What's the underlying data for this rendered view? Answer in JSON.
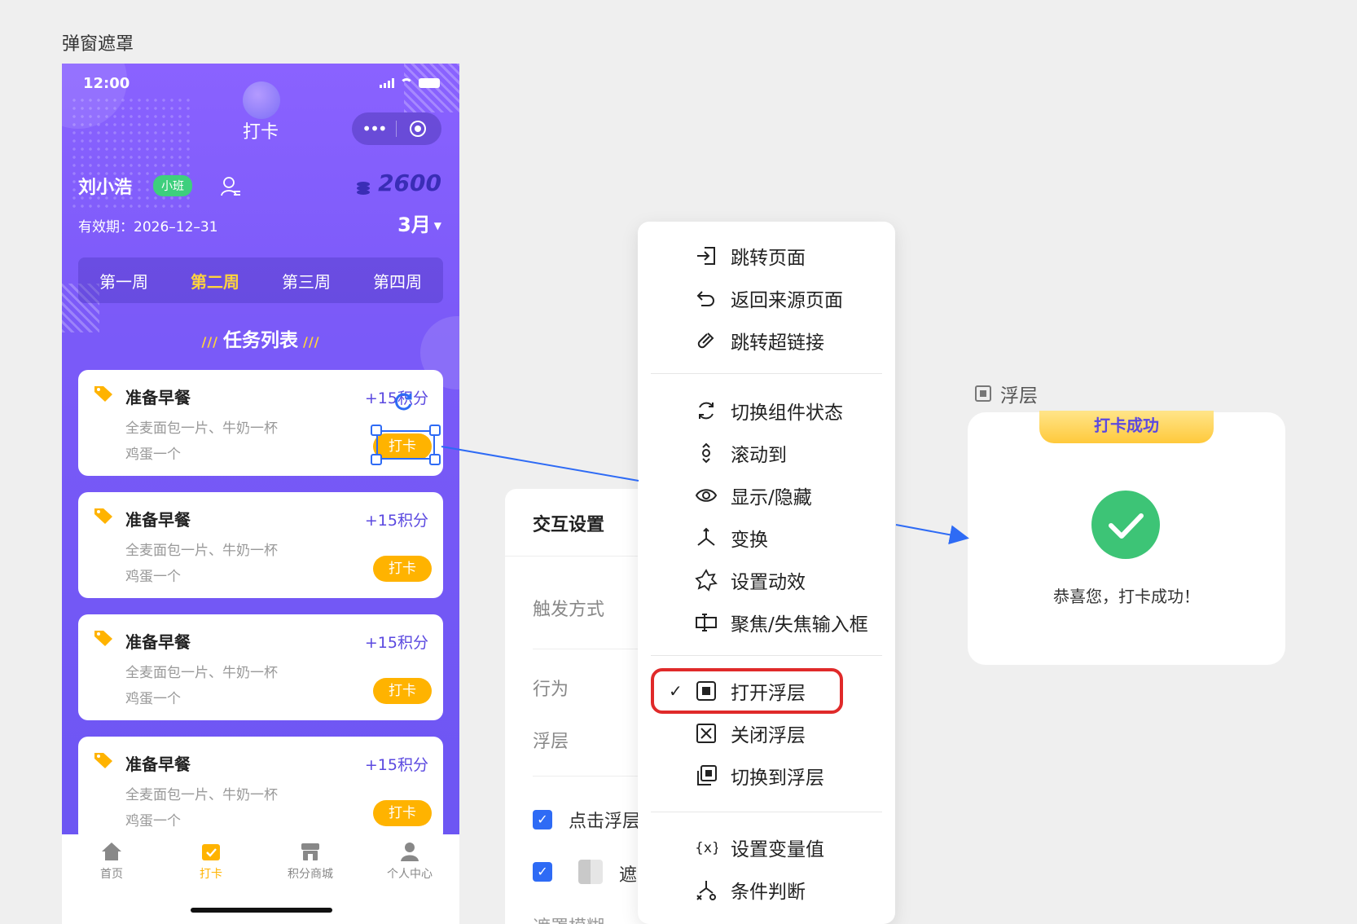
{
  "canvas_title": "弹窗遮罩",
  "phone": {
    "status_time": "12:00",
    "nav_title": "打卡",
    "capsule_more": "•••",
    "user_name": "刘小浩",
    "class_badge": "小班",
    "points": "2600",
    "validity": "有效期：2026–12–31",
    "month": "3月",
    "weeks": [
      "第一周",
      "第二周",
      "第三周",
      "第四周"
    ],
    "active_week": 1,
    "task_header": "任务列表",
    "tasks": [
      {
        "title": "准备早餐",
        "points": "+15积分",
        "desc1": "全麦面包一片、牛奶一杯",
        "desc2": "鸡蛋一个",
        "button": "打卡"
      },
      {
        "title": "准备早餐",
        "points": "+15积分",
        "desc1": "全麦面包一片、牛奶一杯",
        "desc2": "鸡蛋一个",
        "button": "打卡"
      },
      {
        "title": "准备早餐",
        "points": "+15积分",
        "desc1": "全麦面包一片、牛奶一杯",
        "desc2": "鸡蛋一个",
        "button": "打卡"
      },
      {
        "title": "准备早餐",
        "points": "+15积分",
        "desc1": "全麦面包一片、牛奶一杯",
        "desc2": "鸡蛋一个",
        "button": "打卡"
      }
    ],
    "tabs": [
      "首页",
      "打卡",
      "积分商城",
      "个人中心"
    ],
    "active_tab": 1
  },
  "settings": {
    "title": "交互设置",
    "trigger_label": "触发方式",
    "action_label": "行为",
    "overlay_label": "浮层",
    "checkbox1_label": "点击浮层",
    "checkbox2_label": "遮",
    "blur_label": "遮罩模糊"
  },
  "menu": {
    "groups": [
      [
        "跳转页面",
        "返回来源页面",
        "跳转超链接"
      ],
      [
        "切换组件状态",
        "滚动到",
        "显示/隐藏",
        "变换",
        "设置动效",
        "聚焦/失焦输入框"
      ],
      [
        "打开浮层",
        "关闭浮层",
        "切换到浮层"
      ],
      [
        "设置变量值",
        "条件判断"
      ]
    ],
    "items": [
      {
        "label": "跳转页面",
        "icon": "enter-page-icon"
      },
      {
        "label": "返回来源页面",
        "icon": "undo-icon"
      },
      {
        "label": "跳转超链接",
        "icon": "link-icon"
      },
      {
        "label": "切换组件状态",
        "icon": "cycle-icon"
      },
      {
        "label": "滚动到",
        "icon": "scroll-icon"
      },
      {
        "label": "显示/隐藏",
        "icon": "eye-icon"
      },
      {
        "label": "变换",
        "icon": "transform-icon"
      },
      {
        "label": "设置动效",
        "icon": "animation-icon"
      },
      {
        "label": "聚焦/失焦输入框",
        "icon": "focus-input-icon"
      },
      {
        "label": "打开浮层",
        "icon": "open-overlay-icon",
        "checked": true
      },
      {
        "label": "关闭浮层",
        "icon": "close-overlay-icon"
      },
      {
        "label": "切换到浮层",
        "icon": "switch-overlay-icon"
      },
      {
        "label": "设置变量值",
        "icon": "variable-icon"
      },
      {
        "label": "条件判断",
        "icon": "condition-icon"
      }
    ]
  },
  "overlay": {
    "label": "浮层",
    "ribbon": "打卡成功",
    "message": "恭喜您，打卡成功！"
  },
  "colors": {
    "phone_gradient_top": "#8a62ff",
    "accent_yellow": "#ffb300",
    "selection_blue": "#2e6bf5",
    "success_green": "#3dc476",
    "highlight_red": "#e02a2a"
  }
}
